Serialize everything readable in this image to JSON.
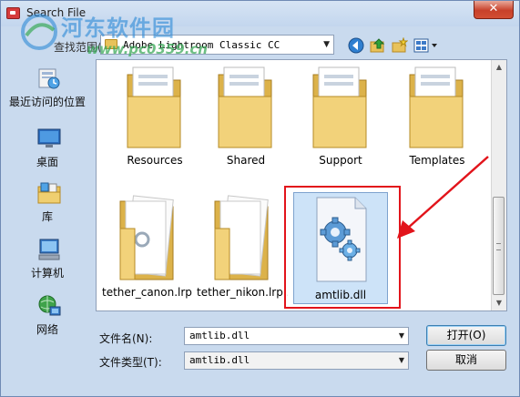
{
  "window": {
    "title": "Search File",
    "close_label": "✕"
  },
  "watermark": {
    "name": "河东软件园",
    "url": "www.pc0359.cn"
  },
  "toolbar": {
    "lookin_label": "查找范围(I):",
    "lookin_value": "Adobe Lightroom Classic CC"
  },
  "places": [
    {
      "label": "最近访问的位置",
      "icon": "recent-places-icon"
    },
    {
      "label": "桌面",
      "icon": "desktop-icon"
    },
    {
      "label": "库",
      "icon": "library-icon"
    },
    {
      "label": "计算机",
      "icon": "computer-icon"
    },
    {
      "label": "网络",
      "icon": "network-icon"
    }
  ],
  "files": [
    {
      "name": "Resources",
      "type": "folder"
    },
    {
      "name": "Shared",
      "type": "folder"
    },
    {
      "name": "Support",
      "type": "folder"
    },
    {
      "name": "Templates",
      "type": "folder"
    },
    {
      "name": "tether_canon.lrp...",
      "type": "folder-open"
    },
    {
      "name": "tether_nikon.lrp...",
      "type": "folder-open"
    },
    {
      "name": "amtlib.dll",
      "type": "dll",
      "selected": true
    }
  ],
  "footer": {
    "filename_label": "文件名(N):",
    "filename_value": "amtlib.dll",
    "filetype_label": "文件类型(T):",
    "filetype_value": "amtlib.dll",
    "open_label": "打开(O)",
    "cancel_label": "取消"
  },
  "colors": {
    "highlight": "#e2141b",
    "selection": "#cde3f8",
    "window_bg": "#c9daee"
  }
}
